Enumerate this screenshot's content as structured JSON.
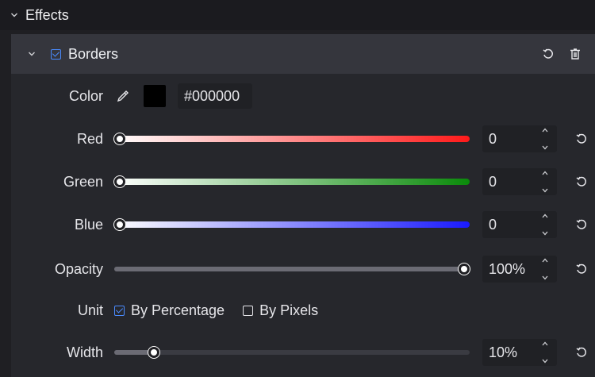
{
  "section": {
    "title": "Effects"
  },
  "group": {
    "title": "Borders",
    "enabled": true
  },
  "color": {
    "label": "Color",
    "hex": "#000000"
  },
  "channels": [
    {
      "label": "Red",
      "value": "0",
      "level": 0
    },
    {
      "label": "Green",
      "value": "0",
      "level": 0
    },
    {
      "label": "Blue",
      "value": "0",
      "level": 0
    }
  ],
  "opacity": {
    "label": "Opacity",
    "value": "100%",
    "level": 1.0
  },
  "unit": {
    "label": "Unit",
    "options": [
      "By Percentage",
      "By Pixels"
    ],
    "selected": "By Percentage"
  },
  "width": {
    "label": "Width",
    "value": "10%",
    "level": 0.1
  },
  "colors": {
    "accent": "#4a8bff",
    "panel": "#26272c",
    "header": "#35363d"
  }
}
